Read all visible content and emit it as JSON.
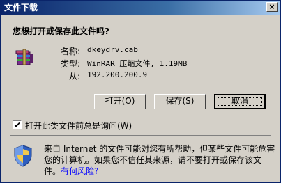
{
  "window": {
    "title": "文件下载",
    "close_label": "×"
  },
  "dialog": {
    "question": "您想打开或保存此文件吗?",
    "file_info": [
      {
        "label": "名称:",
        "value": "dkeydrv.cab"
      },
      {
        "label": "类型:",
        "value": "WinRAR 压缩文件, 1.19MB"
      },
      {
        "label": "从:",
        "value": "192.200.200.9"
      }
    ],
    "buttons": {
      "open": "打开(O)",
      "save": "保存(S)",
      "cancel": "取消"
    },
    "checkbox": {
      "label": "打开此类文件前总是询问(W)",
      "checked": true
    },
    "warning": {
      "text": "来自 Internet 的文件可能对您有所帮助，但某些文件可能危害您的计算机。如果您不信任其来源，请不要打开或保存该文件。",
      "link": "有何风险?"
    }
  },
  "icons": {
    "file": "winrar-archive-icon",
    "shield": "security-shield-icon",
    "close": "close-icon"
  }
}
